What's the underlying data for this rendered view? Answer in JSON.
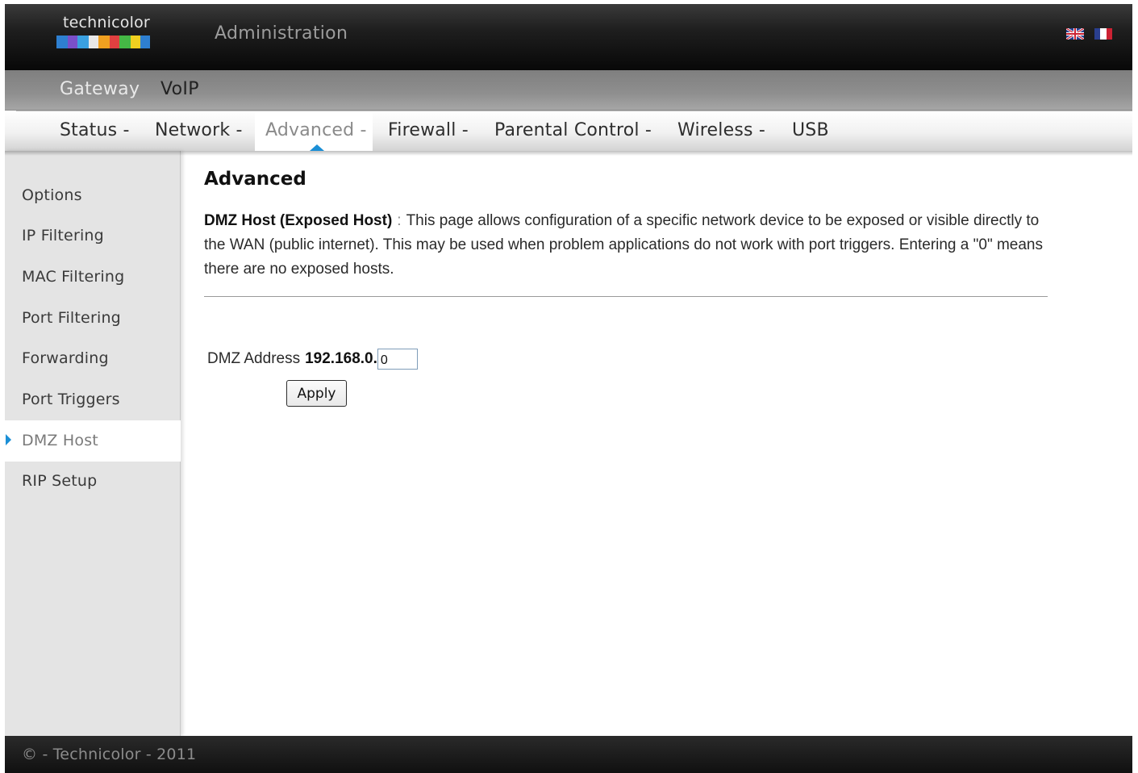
{
  "header": {
    "logo_text": "technicolor",
    "title": "Administration",
    "languages": [
      {
        "code": "en",
        "icon": "uk-flag-icon"
      },
      {
        "code": "fr",
        "icon": "fr-flag-icon"
      }
    ]
  },
  "primary_nav": {
    "items": [
      {
        "label": "Gateway",
        "active": true
      },
      {
        "label": "VoIP",
        "active": false
      }
    ]
  },
  "secondary_nav": {
    "items": [
      {
        "label": "Status -",
        "active": false
      },
      {
        "label": "Network -",
        "active": false
      },
      {
        "label": "Advanced -",
        "active": true
      },
      {
        "label": "Firewall -",
        "active": false
      },
      {
        "label": "Parental Control -",
        "active": false
      },
      {
        "label": "Wireless -",
        "active": false
      },
      {
        "label": "USB",
        "active": false
      }
    ]
  },
  "sidebar": {
    "items": [
      {
        "label": "Options",
        "active": false
      },
      {
        "label": "IP Filtering",
        "active": false
      },
      {
        "label": "MAC Filtering",
        "active": false
      },
      {
        "label": "Port Filtering",
        "active": false
      },
      {
        "label": "Forwarding",
        "active": false
      },
      {
        "label": "Port Triggers",
        "active": false
      },
      {
        "label": "DMZ Host",
        "active": true
      },
      {
        "label": "RIP Setup",
        "active": false
      }
    ]
  },
  "main": {
    "title": "Advanced",
    "description_heading": "DMZ Host (Exposed Host)",
    "description_separator": ":",
    "description_body": "This page allows configuration of a specific network device to be exposed or visible directly to the WAN (public internet). This may be used when problem applications do not work with port triggers. Entering a \"0\" means there are no exposed hosts.",
    "dmz_label": "DMZ Address",
    "dmz_prefix": "192.168.0.",
    "dmz_value": "0",
    "apply_label": "Apply"
  },
  "footer": {
    "text": "© - Technicolor - 2011"
  },
  "colors": {
    "accent": "#1b8fd6",
    "header_bg": "#111111",
    "sidebar_bg": "#e4e4e4"
  }
}
